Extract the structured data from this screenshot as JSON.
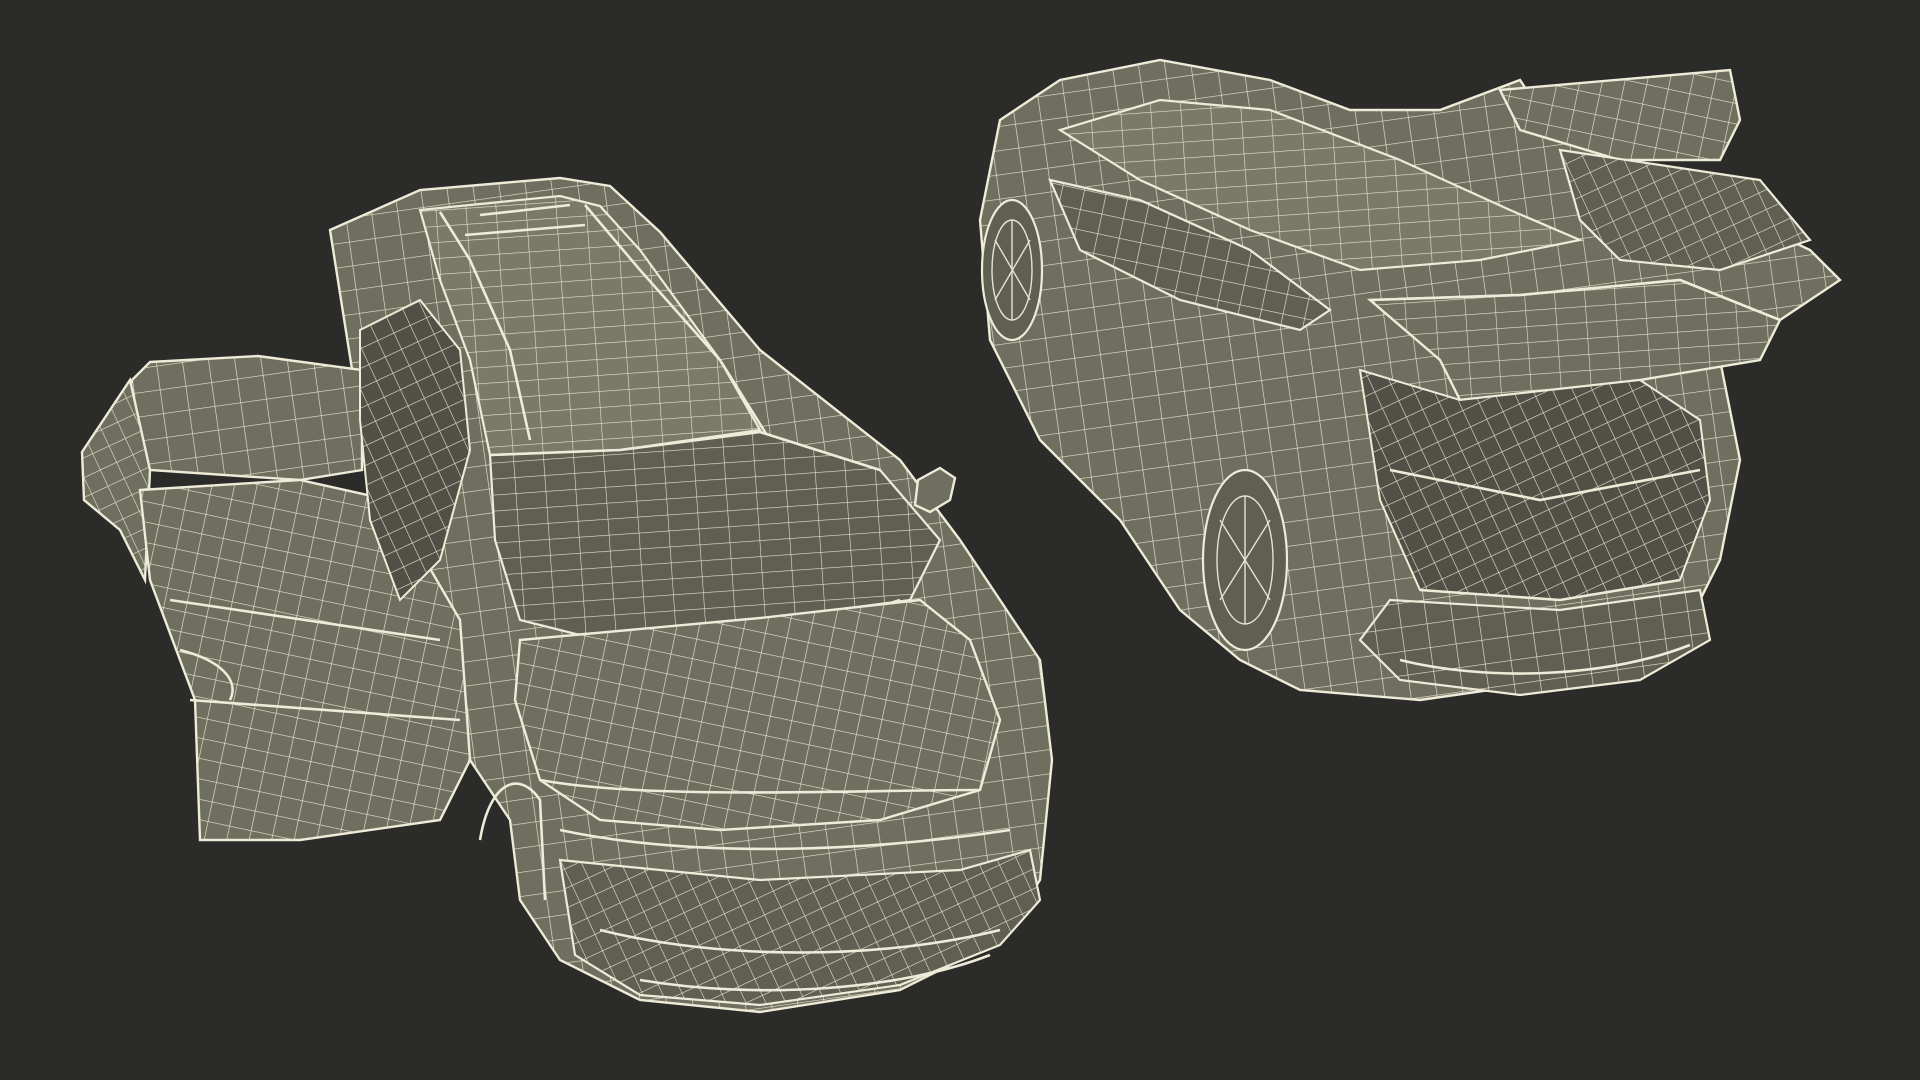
{
  "scene": {
    "background_color": "#2b2b2a",
    "wire_color": "#e6e3cf",
    "surface_color": "#6f6f5f",
    "models": [
      {
        "view": "front-top-left",
        "doors": "open"
      },
      {
        "view": "rear-top-left",
        "tailgate": "open"
      }
    ]
  }
}
